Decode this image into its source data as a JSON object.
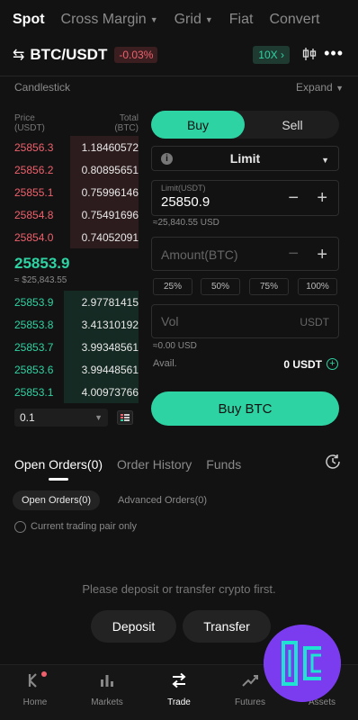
{
  "top_tabs": [
    {
      "label": "Spot",
      "active": true,
      "has_caret": false
    },
    {
      "label": "Cross Margin",
      "active": false,
      "has_caret": true
    },
    {
      "label": "Grid",
      "active": false,
      "has_caret": true
    },
    {
      "label": "Fiat",
      "active": false,
      "has_caret": false
    },
    {
      "label": "Convert",
      "active": false,
      "has_caret": false
    }
  ],
  "pair": {
    "name": "BTC/USDT",
    "change": "-0.03%",
    "leverage": "10X"
  },
  "chart_bar": {
    "label": "Candlestick",
    "expand": "Expand"
  },
  "orderbook": {
    "price_header": "Price\n(USDT)",
    "total_header": "Total\n(BTC)",
    "asks": [
      {
        "price": "25856.3",
        "amount": "1.18460572"
      },
      {
        "price": "25856.2",
        "amount": "0.80895651"
      },
      {
        "price": "25855.1",
        "amount": "0.75996146"
      },
      {
        "price": "25854.8",
        "amount": "0.75491696"
      },
      {
        "price": "25854.0",
        "amount": "0.74052091"
      }
    ],
    "last_price": "25853.9",
    "last_price_usd": "≈ $25,843.55",
    "bids": [
      {
        "price": "25853.9",
        "amount": "2.97781415"
      },
      {
        "price": "25853.8",
        "amount": "3.41310192"
      },
      {
        "price": "25853.7",
        "amount": "3.99348561"
      },
      {
        "price": "25853.6",
        "amount": "3.99448561"
      },
      {
        "price": "25853.1",
        "amount": "4.00973766"
      }
    ],
    "precision": "0.1"
  },
  "order_form": {
    "buy_label": "Buy",
    "sell_label": "Sell",
    "order_type": "Limit",
    "limit_label": "Limit(USDT)",
    "limit_value": "25850.9",
    "limit_usd": "≈25,840.55 USD",
    "amount_placeholder": "Amount(BTC)",
    "percents": [
      "25%",
      "50%",
      "75%",
      "100%"
    ],
    "vol_placeholder": "Vol",
    "vol_unit": "USDT",
    "vol_usd": "≈0.00 USD",
    "avail_label": "Avail.",
    "avail_value": "0  USDT",
    "submit_label": "Buy BTC"
  },
  "orders": {
    "tabs": [
      "Open Orders(0)",
      "Order History",
      "Funds"
    ],
    "sub_tabs": [
      "Open Orders(0)",
      "Advanced Orders(0)"
    ],
    "checkbox_label": "Current trading pair only",
    "empty_message": "Please deposit or transfer crypto first.",
    "deposit_label": "Deposit",
    "transfer_label": "Transfer"
  },
  "bottom_nav": [
    {
      "label": "Home",
      "icon": "home-icon"
    },
    {
      "label": "Markets",
      "icon": "markets-icon"
    },
    {
      "label": "Trade",
      "icon": "trade-icon",
      "active": true
    },
    {
      "label": "Futures",
      "icon": "futures-icon"
    },
    {
      "label": "Assets",
      "icon": "assets-icon"
    }
  ],
  "colors": {
    "accent": "#2ed3a3",
    "ask": "#f0616d",
    "logo_bg": "#7b3cf0"
  }
}
